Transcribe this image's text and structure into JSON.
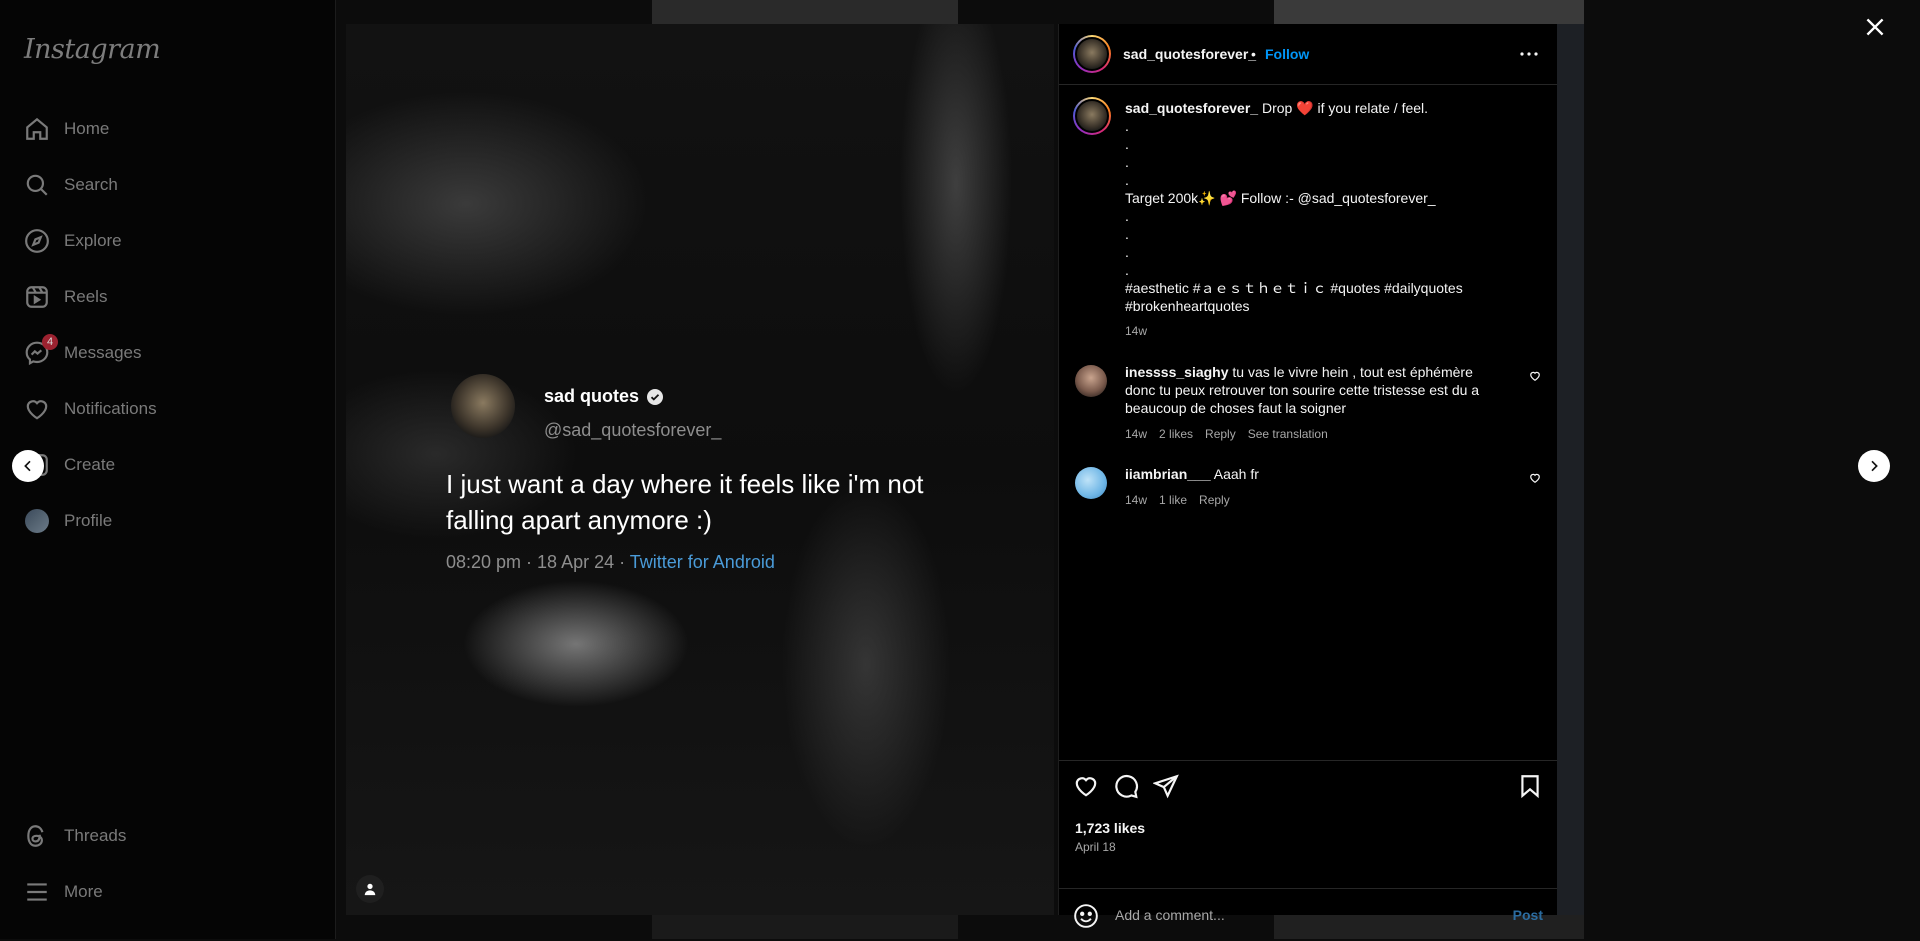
{
  "sidebar": {
    "logo": "Instagram",
    "items": [
      {
        "label": "Home"
      },
      {
        "label": "Search"
      },
      {
        "label": "Explore"
      },
      {
        "label": "Reels"
      },
      {
        "label": "Messages",
        "badge": "4"
      },
      {
        "label": "Notifications"
      },
      {
        "label": "Create"
      },
      {
        "label": "Profile"
      }
    ],
    "bottom": [
      {
        "label": "Threads"
      },
      {
        "label": "More"
      }
    ]
  },
  "media": {
    "tweet_name": "sad quotes",
    "tweet_handle": "@sad_quotesforever_",
    "tweet_text": "I just want a day where it feels like i'm not falling apart anymore :)",
    "tweet_meta": "08:20 pm · 18 Apr 24 · ",
    "tweet_source": "Twitter for Android"
  },
  "post": {
    "username": "sad_quotesforever_",
    "dot": "•",
    "follow_label": "Follow",
    "caption": {
      "username": "sad_quotesforever_",
      "line1_a": "Drop",
      "line1_heart": "❤️",
      "line1_b": "if you relate / feel.",
      "dots_top": [
        ".",
        ".",
        ".",
        "."
      ],
      "target_line_a": "Target 200k",
      "target_emojis": "✨ 💕",
      "target_line_b": "Follow :- @sad_quotesforever_",
      "dots_bottom": [
        ".",
        ".",
        ".",
        "."
      ],
      "hashtags": "#aesthetic #ａｅｓｔｈｅｔｉｃ #quotes #dailyquotes #brokenheartquotes",
      "time": "14w"
    },
    "comments": [
      {
        "username": "inessss_siaghy",
        "text": "tu vas le vivre hein , tout est éphémère donc tu peux retrouver ton sourire cette tristesse est du a beaucoup de choses faut la soigner",
        "time": "14w",
        "likes": "2 likes",
        "reply": "Reply",
        "translate": "See translation"
      },
      {
        "username": "iiambrian___",
        "text": "Aaah fr",
        "time": "14w",
        "likes": "1 like",
        "reply": "Reply"
      }
    ],
    "likes": "1,723 likes",
    "date": "April 18",
    "comment_placeholder": "Add a comment...",
    "post_label": "Post"
  }
}
